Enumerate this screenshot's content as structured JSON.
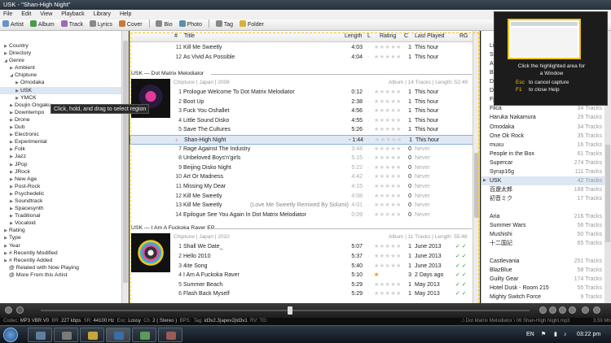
{
  "window": {
    "title": "USK - \"Shan-High Night\""
  },
  "menu": [
    "File",
    "Edit",
    "View",
    "Playback",
    "Library",
    "Help"
  ],
  "toolbar": {
    "left": [
      {
        "label": "Artist",
        "icon": "artist-icon",
        "color": "#6b8fc9"
      },
      {
        "label": "Album",
        "icon": "album-icon",
        "color": "#4b9a4b"
      },
      {
        "label": "Track",
        "icon": "track-icon",
        "color": "#9a6bb3"
      },
      {
        "label": "Lyrics",
        "icon": "lyrics-icon",
        "color": "#888888"
      },
      {
        "label": "Cover",
        "icon": "cover-icon",
        "color": "#c97a3a"
      }
    ],
    "right": [
      {
        "label": "Bio",
        "icon": "bio-icon",
        "color": "#888888"
      },
      {
        "label": "Photo",
        "icon": "photo-icon",
        "color": "#5a8fa8"
      },
      {
        "label": "Tag",
        "icon": "tag-icon",
        "color": "#888888"
      },
      {
        "label": "Folder",
        "icon": "folder-icon",
        "color": "#d8b03a"
      }
    ]
  },
  "tree": [
    {
      "label": "Country",
      "indent": 1,
      "arrow": "▶"
    },
    {
      "label": "Directory",
      "indent": 1,
      "arrow": "▶"
    },
    {
      "label": "Genre",
      "indent": 1,
      "arrow": "◢"
    },
    {
      "label": "Ambient",
      "indent": 2,
      "arrow": "▶"
    },
    {
      "label": "Chiptune",
      "indent": 2,
      "arrow": "◢"
    },
    {
      "label": "Omodaka",
      "indent": 3,
      "arrow": "▶"
    },
    {
      "label": "USK",
      "indent": 3,
      "arrow": "▶",
      "selected": true
    },
    {
      "label": "YMCK",
      "indent": 3,
      "arrow": "▶"
    },
    {
      "label": "Doujin Ongaku",
      "indent": 2,
      "arrow": "▶"
    },
    {
      "label": "Downtempo",
      "indent": 2,
      "arrow": "▶"
    },
    {
      "label": "Drone",
      "indent": 2,
      "arrow": "▶"
    },
    {
      "label": "Dub",
      "indent": 2,
      "arrow": "▶"
    },
    {
      "label": "Electronic",
      "indent": 2,
      "arrow": "▶"
    },
    {
      "label": "Experimental",
      "indent": 2,
      "arrow": "▶"
    },
    {
      "label": "Folk",
      "indent": 2,
      "arrow": "▶"
    },
    {
      "label": "Jazz",
      "indent": 2,
      "arrow": "▶"
    },
    {
      "label": "JPop",
      "indent": 2,
      "arrow": "▶"
    },
    {
      "label": "JRock",
      "indent": 2,
      "arrow": "▶"
    },
    {
      "label": "New Age",
      "indent": 2,
      "arrow": "▶"
    },
    {
      "label": "Post-Rock",
      "indent": 2,
      "arrow": "▶"
    },
    {
      "label": "Psychedelic",
      "indent": 2,
      "arrow": "▶"
    },
    {
      "label": "Soundtrack",
      "indent": 2,
      "arrow": "▶"
    },
    {
      "label": "Spacesynth",
      "indent": 2,
      "arrow": "▶"
    },
    {
      "label": "Traditional",
      "indent": 2,
      "arrow": "▶"
    },
    {
      "label": "Vocaloid",
      "indent": 2,
      "arrow": "▶"
    },
    {
      "label": "Rating",
      "indent": 1,
      "arrow": "▶"
    },
    {
      "label": "Type",
      "indent": 1,
      "arrow": "▶"
    },
    {
      "label": "Year",
      "indent": 1,
      "arrow": "▶"
    },
    {
      "label": "# Recently Modified",
      "indent": 1,
      "arrow": "▶"
    },
    {
      "label": "# Recently Added",
      "indent": 1,
      "arrow": "▶"
    },
    {
      "label": "@ Related with Now Playing",
      "indent": 1,
      "arrow": ""
    },
    {
      "label": "@ More From this Artist",
      "indent": 1,
      "arrow": ""
    }
  ],
  "columns": {
    "num": "#",
    "title": "Title",
    "length": "Length",
    "l": "L",
    "rating": "Rating",
    "c": "C",
    "last_played": "Last Played",
    "rg": "RG"
  },
  "top_tracks": [
    {
      "num": "11",
      "title": "Kill Me Sweetly",
      "length": "4:03",
      "stars": 0,
      "count": "1",
      "last": "This hour",
      "dim": false
    },
    {
      "num": "12",
      "title": "As Vivid As Possible",
      "length": "4:04",
      "stars": 0,
      "count": "1",
      "last": "This hour",
      "dim": false
    }
  ],
  "album1": {
    "header": "USK  —  Dot Matrix Melodiator",
    "info": "Chiptune  |  Japan  |  2008",
    "summary": "Album  |  14 Tracks  |  Length: 52:49",
    "tracks": [
      {
        "num": "1",
        "title": "Prologue Welcome To Dot Matrix Melodiator",
        "length": "0:12",
        "stars": 0,
        "count": "1",
        "last": "This hour",
        "dim": false
      },
      {
        "num": "2",
        "title": "Boot Up",
        "length": "2:38",
        "stars": 0,
        "count": "1",
        "last": "This hour",
        "dim": false
      },
      {
        "num": "3",
        "title": "Fuck You Oshallet",
        "length": "4:56",
        "stars": 0,
        "count": "1",
        "last": "This hour",
        "dim": false
      },
      {
        "num": "4",
        "title": "Little Sound Disko",
        "length": "4:55",
        "stars": 0,
        "count": "1",
        "last": "This hour",
        "dim": false
      },
      {
        "num": "5",
        "title": "Save The Cultures",
        "length": "5:26",
        "stars": 0,
        "count": "1",
        "last": "This hour",
        "dim": false
      },
      {
        "num": "6",
        "title": "Shan-High Night",
        "length": "- 1:44",
        "stars": 0,
        "count": "1",
        "last": "This hour",
        "dim": false,
        "playing": true
      },
      {
        "num": "7",
        "title": "Rage Against The Industry",
        "length": "3:48",
        "stars": 0,
        "count": "0",
        "last": "Never",
        "dim": true
      },
      {
        "num": "8",
        "title": "Unbeloved Boys'n'girls",
        "length": "5:15",
        "stars": 0,
        "count": "0",
        "last": "Never",
        "dim": true
      },
      {
        "num": "9",
        "title": "Beijing Disko Night",
        "length": "5:22",
        "stars": 0,
        "count": "0",
        "last": "Never",
        "dim": true
      },
      {
        "num": "10",
        "title": "Art Or Madness",
        "length": "4:42",
        "stars": 0,
        "count": "0",
        "last": "Never",
        "dim": true
      },
      {
        "num": "11",
        "title": "Missing My Dear",
        "length": "4:15",
        "stars": 0,
        "count": "0",
        "last": "Never",
        "dim": true
      },
      {
        "num": "12",
        "title": "Kill Me Sweetly",
        "length": "4:08",
        "stars": 0,
        "count": "0",
        "last": "Never",
        "dim": true
      },
      {
        "num": "13",
        "title": "Kill Me Sweetly",
        "subtitle": "(Love Me Sweetly Remixed By Solumi)",
        "length": "4:01",
        "stars": 0,
        "count": "0",
        "last": "Never",
        "dim": true
      },
      {
        "num": "14",
        "title": "Epilogue See You Again In Dot Matrix Melodiator",
        "length": "0:09",
        "stars": 0,
        "count": "0",
        "last": "Never",
        "dim": true
      }
    ]
  },
  "album2": {
    "header": "USK  —  I Am A Fuckoka Raver EP",
    "info": "Chiptune  |  Japan  |  2010",
    "summary": "Album  |  11 Tracks  |  Length: 55:46",
    "tracks": [
      {
        "num": "1",
        "title": "Shall We Date_",
        "length": "5:07",
        "stars": 0,
        "count": "1",
        "last": "June 2013",
        "rg": "✓ ✓"
      },
      {
        "num": "2",
        "title": "Hello 2010",
        "length": "5:37",
        "stars": 0,
        "count": "1",
        "last": "June 2013",
        "rg": "✓ ✓"
      },
      {
        "num": "3",
        "title": "4ite Song",
        "length": "5:40",
        "stars": 0,
        "count": "1",
        "last": "June 2013",
        "rg": "✓ ✓"
      },
      {
        "num": "4",
        "title": "I Am A Fuckoka Raver",
        "length": "5:10",
        "stars": 4,
        "count": "3",
        "last": "2 Days ago",
        "rg": "✓ ✓"
      },
      {
        "num": "5",
        "title": "Summer Beach",
        "length": "5:29",
        "stars": 0,
        "count": "1",
        "last": "May 2013",
        "rg": "✓ ✓"
      },
      {
        "num": "6",
        "title": "Flash Back Myself",
        "length": "5:29",
        "stars": 0,
        "count": "1",
        "last": "May 2013",
        "rg": "✓ ✓"
      }
    ]
  },
  "tooltip": "Click, hold, and drag to select region",
  "capture": {
    "line1": "Click the highlighted area for",
    "line2": "a Window",
    "key1": "Esc",
    "text1": "to cancel capture",
    "key2": "F1",
    "text2": "to close Help"
  },
  "artists": [
    {
      "name": "",
      "count": ""
    },
    {
      "name": "Library",
      "count": ""
    },
    {
      "name": "Search",
      "count": ""
    },
    {
      "name": "Ali",
      "count": ""
    },
    {
      "name": "Bump of C",
      "count": ""
    },
    {
      "name": "Daft",
      "count": ""
    },
    {
      "name": "Deep Sea",
      "count": ""
    },
    {
      "name": "Fjordne",
      "count": "30 Tracks"
    },
    {
      "name": "Flica",
      "count": "34 Tracks"
    },
    {
      "name": "Haruka Nakamura",
      "count": "29 Tracks"
    },
    {
      "name": "Omodaka",
      "count": "34 Tracks"
    },
    {
      "name": "One Ok Rock",
      "count": "35 Tracks"
    },
    {
      "name": "muxu",
      "count": "16 Tracks"
    },
    {
      "name": "People in the Box",
      "count": "61 Tracks"
    },
    {
      "name": "Supercar",
      "count": "274 Tracks"
    },
    {
      "name": "Syrup16g",
      "count": "111 Tracks"
    },
    {
      "name": "USK",
      "count": "42 Tracks",
      "selected": true,
      "arrow": true
    },
    {
      "name": "百遼太郎",
      "count": "188 Tracks"
    },
    {
      "name": "初音ミク",
      "count": "17 Tracks"
    },
    {
      "name": "",
      "count": ""
    },
    {
      "name": "Aria",
      "count": "216 Tracks"
    },
    {
      "name": "Summer Wars",
      "count": "56 Tracks"
    },
    {
      "name": "Mushishi",
      "count": "50 Tracks"
    },
    {
      "name": "十二国記",
      "count": "65 Tracks"
    },
    {
      "name": "",
      "count": ""
    },
    {
      "name": "Castlevania",
      "count": "251 Tracks"
    },
    {
      "name": "BlazBlue",
      "count": "58 Tracks"
    },
    {
      "name": "Guilty Gear",
      "count": "174 Tracks"
    },
    {
      "name": "Hotel Dusk - Room 215",
      "count": "55 Tracks"
    },
    {
      "name": "Mighty Switch Force",
      "count": "9 Tracks"
    }
  ],
  "status": {
    "codec_label": "Codec:",
    "codec": "MP3 VBR V0",
    "br_label": "BR:",
    "br": "227 kbps",
    "sr_label": "SR:",
    "sr": "44100 Hz",
    "enc_label": "Enc:",
    "enc": "Lossy",
    "ch_label": "Ch:",
    "ch": "2 ( Stereo )",
    "bps_label": "BPS:",
    "tag_label": "Tag:",
    "tag": "id3v2.3|apev2|id3v1",
    "rv_label": "RV:",
    "tg_label": "TG:",
    "path": "..\\ Dot Matrix Melodiator \\ 06 Shan-High Night.mp3",
    "size": "3.59 Mb"
  },
  "tray": {
    "lang": "EN",
    "time": "03:22 pm"
  },
  "colors": {
    "accent": "#f2c318",
    "selected": "#dfe8f6",
    "star": "#f5a12a",
    "rg_check": "#2a9a2a"
  }
}
